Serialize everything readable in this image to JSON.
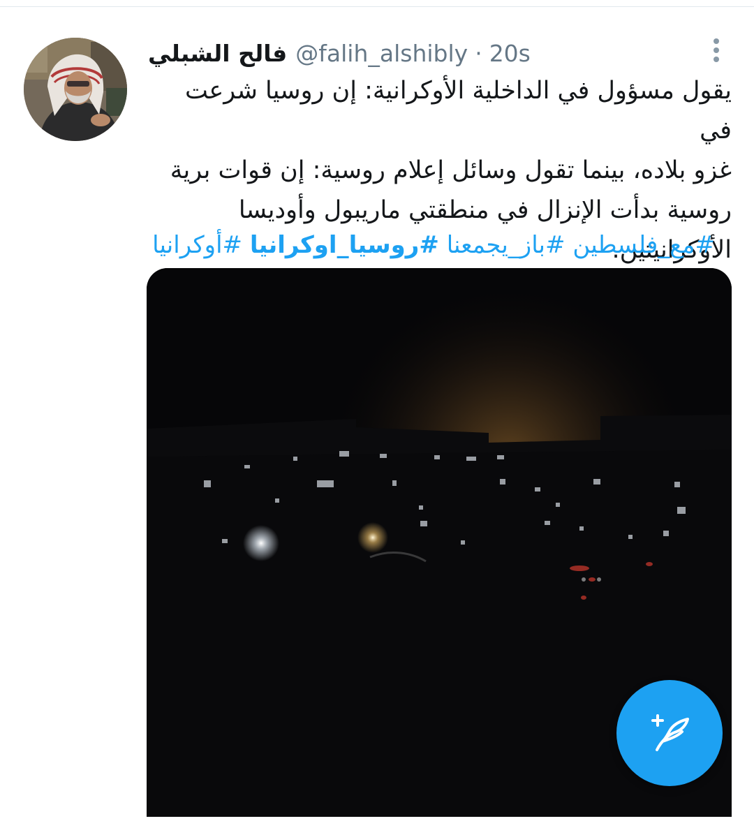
{
  "tweet": {
    "display_name": "فالح الشبلي",
    "handle": "@falih_alshibly",
    "separator": "·",
    "time": "20s",
    "body_lines": [
      "يقول مسؤول في الداخلية الأوكرانية: إن روسيا شرعت في",
      "غزو بلاده، بينما تقول وسائل إعلام روسية: إن قوات برية",
      "روسية بدأت الإنزال في منطقتي ماريبول وأوديسا",
      "الأوكرانيتين."
    ],
    "hashtags": [
      "#أوكرانيا",
      "#روسيا_اوكرانيا",
      "#باز_يجمعنا",
      "#مع_فلسطين"
    ]
  },
  "icons": {
    "more": "more-vertical-icon",
    "compose": "compose-tweet-icon"
  },
  "colors": {
    "accent": "#1da1f2",
    "text": "#14171a",
    "muted": "#657786"
  }
}
